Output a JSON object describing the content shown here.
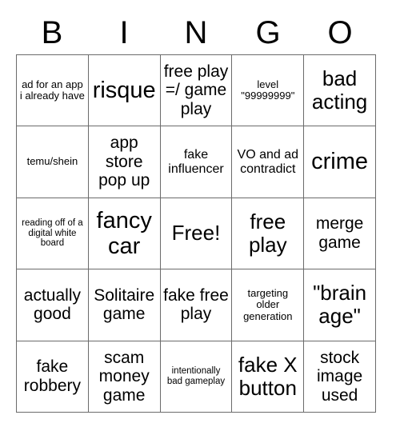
{
  "card": {
    "title_letters": [
      "B",
      "I",
      "N",
      "G",
      "O"
    ],
    "columns": 5,
    "rows": 5,
    "free_space_index": 12,
    "colors": {
      "background": "#ffffff",
      "border": "#6b6b6b",
      "text": "#000000"
    },
    "cells": [
      {
        "text": "ad for an app i already have",
        "size": "xs"
      },
      {
        "text": "risque",
        "size": "xl"
      },
      {
        "text": "free play =/ game play",
        "size": "md"
      },
      {
        "text": "level \"99999999\"",
        "size": "xs"
      },
      {
        "text": "bad acting",
        "size": "lg"
      },
      {
        "text": "temu/shein",
        "size": "xs"
      },
      {
        "text": "app store pop up",
        "size": "md"
      },
      {
        "text": "fake influencer",
        "size": "sm"
      },
      {
        "text": "VO and ad contradict",
        "size": "sm"
      },
      {
        "text": "crime",
        "size": "xl"
      },
      {
        "text": "reading off of a digital white board",
        "size": "xxs"
      },
      {
        "text": "fancy car",
        "size": "xl"
      },
      {
        "text": "Free!",
        "size": "lg"
      },
      {
        "text": "free play",
        "size": "lg"
      },
      {
        "text": "merge game",
        "size": "md"
      },
      {
        "text": "actually good",
        "size": "md"
      },
      {
        "text": "Solitaire game",
        "size": "md"
      },
      {
        "text": "fake free play",
        "size": "md"
      },
      {
        "text": "targeting older generation",
        "size": "xs"
      },
      {
        "text": "\"brain age\"",
        "size": "lg"
      },
      {
        "text": "fake robbery",
        "size": "md"
      },
      {
        "text": "scam money game",
        "size": "md"
      },
      {
        "text": "intentionally bad gameplay",
        "size": "xxs"
      },
      {
        "text": "fake X button",
        "size": "lg"
      },
      {
        "text": "stock image used",
        "size": "md"
      }
    ]
  }
}
